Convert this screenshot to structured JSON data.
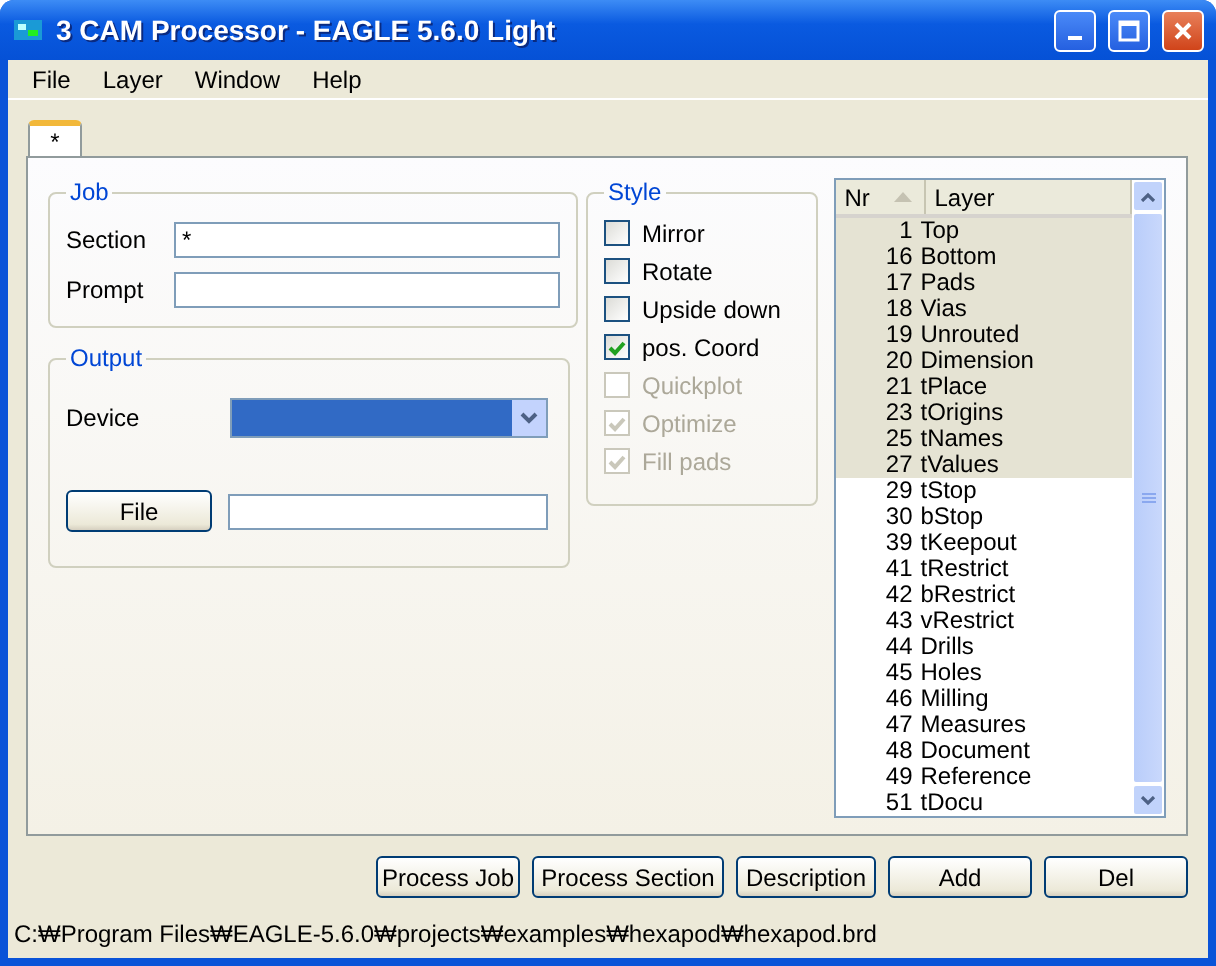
{
  "window": {
    "title": "3 CAM Processor - EAGLE 5.6.0 Light"
  },
  "menu": [
    "File",
    "Layer",
    "Window",
    "Help"
  ],
  "tabs": [
    {
      "label": "*",
      "selected": true
    }
  ],
  "job": {
    "title": "Job",
    "fields": [
      {
        "label": "Section",
        "value": "*"
      },
      {
        "label": "Prompt"
      }
    ]
  },
  "output": {
    "title": "Output",
    "device_label": "Device",
    "file_button": "File"
  },
  "style": {
    "title": "Style",
    "options": [
      {
        "label": "Mirror",
        "checked": false,
        "disabled": false
      },
      {
        "label": "Rotate",
        "checked": false,
        "disabled": false
      },
      {
        "label": "Upside down",
        "checked": false,
        "disabled": false
      },
      {
        "label": "pos. Coord",
        "checked": true,
        "disabled": false
      },
      {
        "label": "Quickplot",
        "checked": false,
        "disabled": true
      },
      {
        "label": "Optimize",
        "checked": true,
        "disabled": true
      },
      {
        "label": "Fill pads",
        "checked": true,
        "disabled": true
      }
    ]
  },
  "layers": {
    "columns": [
      "Nr",
      "Layer"
    ],
    "rows": [
      {
        "nr": "1",
        "name": "Top",
        "selected": true
      },
      {
        "nr": "16",
        "name": "Bottom",
        "selected": true
      },
      {
        "nr": "17",
        "name": "Pads",
        "selected": true
      },
      {
        "nr": "18",
        "name": "Vias",
        "selected": true
      },
      {
        "nr": "19",
        "name": "Unrouted",
        "selected": true
      },
      {
        "nr": "20",
        "name": "Dimension",
        "selected": true
      },
      {
        "nr": "21",
        "name": "tPlace",
        "selected": true
      },
      {
        "nr": "23",
        "name": "tOrigins",
        "selected": true
      },
      {
        "nr": "25",
        "name": "tNames",
        "selected": true
      },
      {
        "nr": "27",
        "name": "tValues",
        "selected": true
      },
      {
        "nr": "29",
        "name": "tStop",
        "selected": false
      },
      {
        "nr": "30",
        "name": "bStop",
        "selected": false
      },
      {
        "nr": "39",
        "name": "tKeepout",
        "selected": false
      },
      {
        "nr": "41",
        "name": "tRestrict",
        "selected": false
      },
      {
        "nr": "42",
        "name": "bRestrict",
        "selected": false
      },
      {
        "nr": "43",
        "name": "vRestrict",
        "selected": false
      },
      {
        "nr": "44",
        "name": "Drills",
        "selected": false
      },
      {
        "nr": "45",
        "name": "Holes",
        "selected": false
      },
      {
        "nr": "46",
        "name": "Milling",
        "selected": false
      },
      {
        "nr": "47",
        "name": "Measures",
        "selected": false
      },
      {
        "nr": "48",
        "name": "Document",
        "selected": false
      },
      {
        "nr": "49",
        "name": "Reference",
        "selected": false
      },
      {
        "nr": "51",
        "name": "tDocu",
        "selected": false
      }
    ]
  },
  "buttons": [
    "Process Job",
    "Process Section",
    "Description",
    "Add",
    "Del"
  ],
  "status_bar": "C:₩Program Files₩EAGLE-5.6.0₩projects₩examples₩hexapod₩hexapod.brd"
}
